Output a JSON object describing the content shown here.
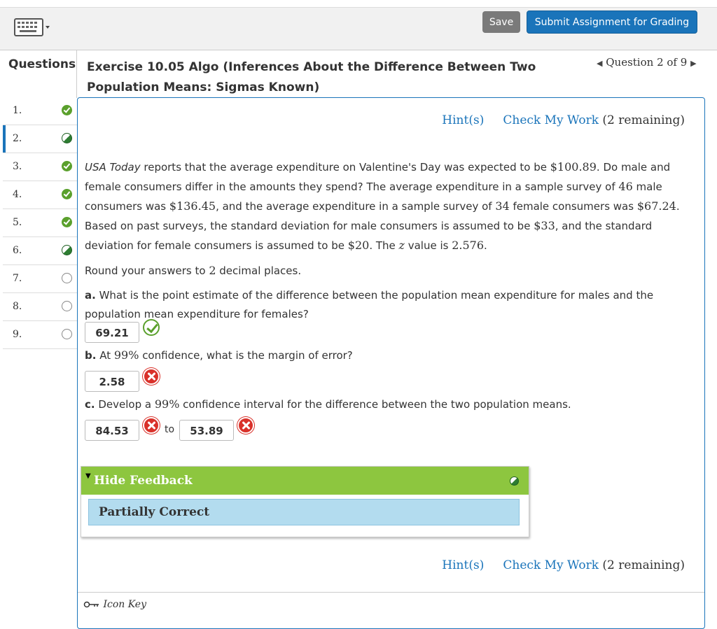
{
  "toolbar": {
    "keyboard_icon": "keyboard-icon",
    "save_label": "Save",
    "submit_label": "Submit Assignment for Grading"
  },
  "header": {
    "questions_label": "Questions",
    "exercise_title": "Exercise 10.05 Algo (Inferences About the Difference Between Two Population Means: Sigmas Known)",
    "question_nav": "Question 2 of 9"
  },
  "sidebar": {
    "items": [
      {
        "num": "1.",
        "status": "correct"
      },
      {
        "num": "2.",
        "status": "partial"
      },
      {
        "num": "3.",
        "status": "correct"
      },
      {
        "num": "4.",
        "status": "correct"
      },
      {
        "num": "5.",
        "status": "correct"
      },
      {
        "num": "6.",
        "status": "partial"
      },
      {
        "num": "7.",
        "status": "empty"
      },
      {
        "num": "8.",
        "status": "empty"
      },
      {
        "num": "9.",
        "status": "empty"
      }
    ]
  },
  "hints": {
    "hint_label": "Hint(s)",
    "check_label": "Check My Work",
    "remaining": "(2 remaining)"
  },
  "problem": {
    "source": "USA Today",
    "t1": " reports that the average expenditure on Valentine's Day was expected to be ",
    "v1": "$100.89",
    "t2": ". Do male and female consumers differ in the amounts they spend? The average expenditure in a sample survey of ",
    "v2": "46",
    "t3": " male consumers was ",
    "v3": "$136.45",
    "t4": ", and the average expenditure in a sample survey of ",
    "v4": "34",
    "t5": " female consumers was ",
    "v5": "$67.24",
    "t6": ". Based on past surveys, the standard deviation for male consumers is assumed to be ",
    "v6": "$33",
    "t7": ", and the standard deviation for female consumers is assumed to be ",
    "v7": "$20",
    "t8": ". The ",
    "zvar": "z",
    "t9": " value is ",
    "v8": "2.576",
    "t10": ".",
    "round_pre": "Round your answers to ",
    "round_num": "2",
    "round_post": " decimal places.",
    "a_label": "a.",
    "a_text": " What is the point estimate of the difference between the population mean expenditure for males and the population mean expenditure for females?",
    "b_label": "b.",
    "b_pre": " At ",
    "b_pct": "99%",
    "b_post": " confidence, what is the margin of error?",
    "c_label": "c.",
    "c_pre": " Develop a ",
    "c_pct": "99%",
    "c_post": " confidence interval for the difference between the two population means.",
    "to_label": "to"
  },
  "answers": {
    "a": {
      "value": "69.21",
      "status": "correct"
    },
    "b": {
      "value": "2.58",
      "status": "incorrect"
    },
    "c_low": {
      "value": "84.53",
      "status": "incorrect"
    },
    "c_high": {
      "value": "53.89",
      "status": "incorrect"
    }
  },
  "feedback": {
    "toggle_label": "Hide Feedback",
    "status_text": "Partially Correct"
  },
  "footer": {
    "icon_key_label": "Icon Key"
  }
}
